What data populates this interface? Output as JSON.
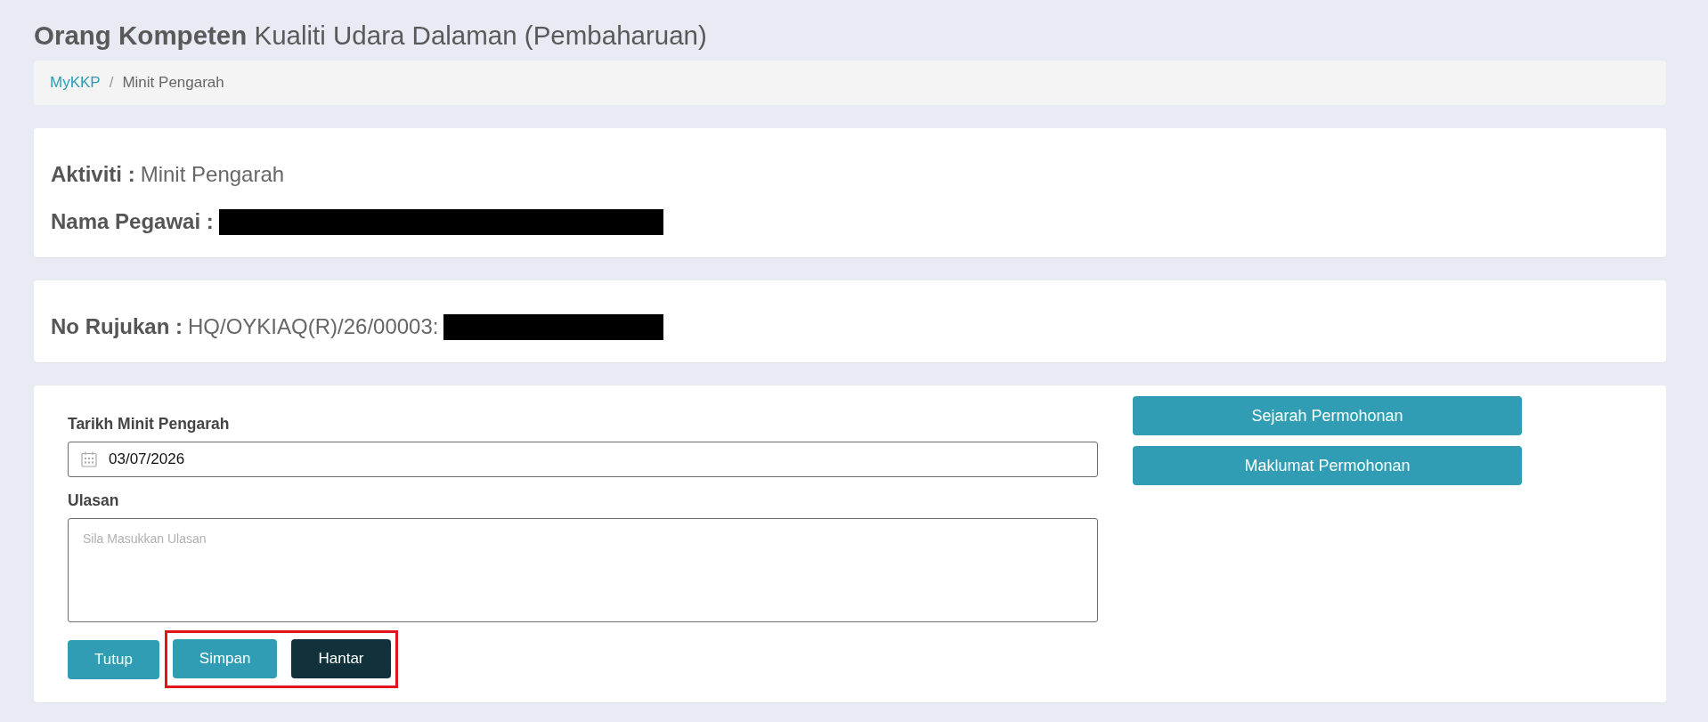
{
  "header": {
    "title": "**Orang Kompeten** Kualiti Udara Dalaman (Pembaharuan)"
  },
  "breadcrumb": {
    "separator": "/",
    "items": [
      {
        "label": "MyKKP",
        "kind": "link"
      },
      {
        "label": "Minit Pengarah",
        "kind": "current"
      }
    ]
  },
  "info_cards": [
    {
      "fields": [
        {
          "label": "Aktiviti :",
          "value": "Minit Pengarah",
          "redacted": false
        },
        {
          "label": "Nama Pegawai :",
          "redacted": true
        }
      ]
    },
    {
      "fields": [
        {
          "label": "No Rujukan :",
          "value": "HQ/OYKIAQ(R)/26/00003:",
          "redacted": true
        }
      ]
    }
  ],
  "form": {
    "date_field": {
      "label": "Tarikh Minit Pengarah",
      "value": "03/07/2026"
    },
    "comment_field": {
      "label": "Ulasan",
      "placeholder": "Sila Masukkan Ulasan"
    },
    "actions": [
      {
        "label": "Tutup",
        "kind": "primary",
        "highlighted": false
      },
      {
        "label": "Simpan",
        "kind": "primary",
        "highlighted": true
      },
      {
        "label": "Hantar",
        "kind": "dark",
        "highlighted": true
      }
    ],
    "side_buttons": [
      {
        "label": "Sejarah Permohonan"
      },
      {
        "label": "Maklumat Permohonan"
      }
    ]
  }
}
